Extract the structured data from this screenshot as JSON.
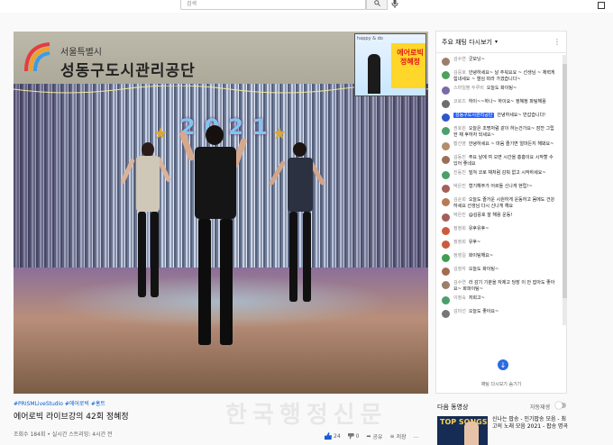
{
  "search": {
    "placeholder": "검색"
  },
  "video": {
    "logo_line1": "서울특별시",
    "logo_line2": "성동구도시관리공단",
    "balloon_numbers": "2021",
    "thumb_title": "에어로빅 정혜정",
    "thumb_small": "happy & do"
  },
  "hashtags": "#PRISMLiveStudio #에어로빅 #홍트",
  "title": "에어로빅 라이브강의 42회 정혜정",
  "meta": "조회수 184회 • 실시간 스트리밍: 4시간 전",
  "actions": {
    "like_count": "24",
    "dislike_count": "0",
    "share": "공유",
    "save": "저장"
  },
  "watermark": "한국행정신문",
  "chat": {
    "header": "주요 채팅 다시보기",
    "footer": "채팅 다시보기 숨기기",
    "messages": [
      {
        "author": "김수연",
        "text": "굿모닝~",
        "color": "#9c7e6a"
      },
      {
        "author": "김응호",
        "text": "안녕하세요~ 날 추워요요 ~ 선생님 ~ 체력게 힘내세요 ~ 열심 따라 가겠습니다~",
        "color": "#4ea05a"
      },
      {
        "author": "스마일짱 두루비",
        "text": "오늘도 화이팅~",
        "color": "#7a6aa8"
      },
      {
        "author": "코로즈",
        "text": "하이~~하나~ 하이요~ 정혜정 파팅해용",
        "color": "#6c6c6c"
      },
      {
        "author": "성동구도시관리공단",
        "text": "안녕하세요~ 반갑습니다!",
        "color": "#2f56c9",
        "owner": true
      },
      {
        "author": "권호원",
        "text": "오늘은 조명처럼 같이 하는건가요~ 잠깐 그립 한 채 후하자 되세요~",
        "color": "#4aa06a"
      },
      {
        "author": "황선영",
        "text": "안녕하세요 ~ 마음 즐기면 얼마든지 해봐요~",
        "color": "#b48d6a"
      },
      {
        "author": "김동진",
        "text": "주요 날에 여 오면 시간을 흥흥이요 시작할 수 있어 좋네요",
        "color": "#9b6f55"
      },
      {
        "author": "진동진",
        "text": "밀쳐 코로 채처럼 감춰 없고 시작하세요~",
        "color": "#4aa06a"
      },
      {
        "author": "박은진",
        "text": "형기해주가 어르들 신나게 현립!~",
        "color": "#a35f58"
      },
      {
        "author": "김순희",
        "text": "오늘도 즐거운 시원하게 운동하고 몸에도 건강하세요 선생님 다시 신나게 해요",
        "color": "#b87a55"
      },
      {
        "author": "박은진",
        "text": "@김응호 잘 해용 운동!",
        "color": "#a35f58"
      },
      {
        "author": "정정희",
        "text": "유후유후~",
        "color": "#cc5b3d"
      },
      {
        "author": "정정희",
        "text": "유후~",
        "color": "#cc5b3d"
      },
      {
        "author": "정영길",
        "text": "화이팅해요~",
        "color": "#3f9e4f"
      },
      {
        "author": "김정자",
        "text": "오늘도 화이팅~",
        "color": "#a36c4f"
      },
      {
        "author": "김수연",
        "text": "라 감기 기분을 자제고 당장 이 안 잡아도 좋아요~ 화파이팅~",
        "color": "#9c7e6a"
      },
      {
        "author": "이정숙",
        "text": "저희고~",
        "color": "#4aa06a"
      },
      {
        "author": "김미선",
        "text": "오늘도 좋아요~",
        "color": "#777777"
      }
    ]
  },
  "sidebar": {
    "next_label": "다음 동영상",
    "autoplay_label": "자동재생",
    "next_thumb_text": "TOP SONGS",
    "next_title": "신나는 팝송 - 인기팝송 모음 - 최고의 노래 모음 2021 - 팝송 명곡"
  }
}
